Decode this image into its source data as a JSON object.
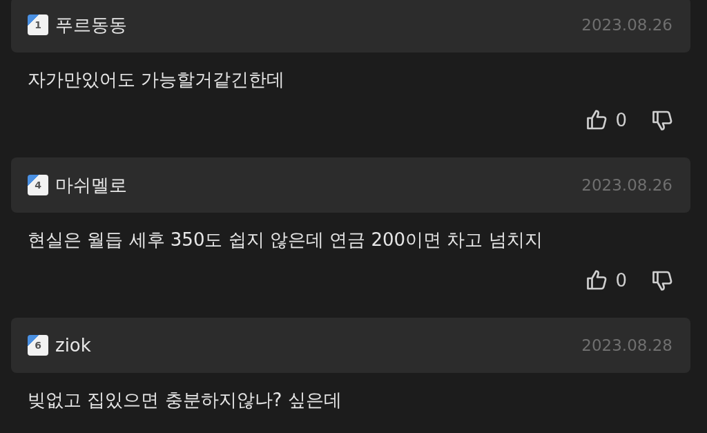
{
  "comments": [
    {
      "level_badge": "1",
      "author": "푸르동동",
      "date": "2023.08.26",
      "text": "자가만있어도 가능할거같긴한데",
      "votes": {
        "likes": "0"
      }
    },
    {
      "level_badge": "4",
      "author": "마쉬멜로",
      "date": "2023.08.26",
      "text": "현실은 월듭 세후 350도 쉽지 않은데 연금 200이면 차고 넘치지",
      "votes": {
        "likes": "0"
      }
    },
    {
      "level_badge": "6",
      "author": "ziok",
      "date": "2023.08.28",
      "text": "빚없고 집있으면 충분하지않나? 싶은데"
    }
  ]
}
